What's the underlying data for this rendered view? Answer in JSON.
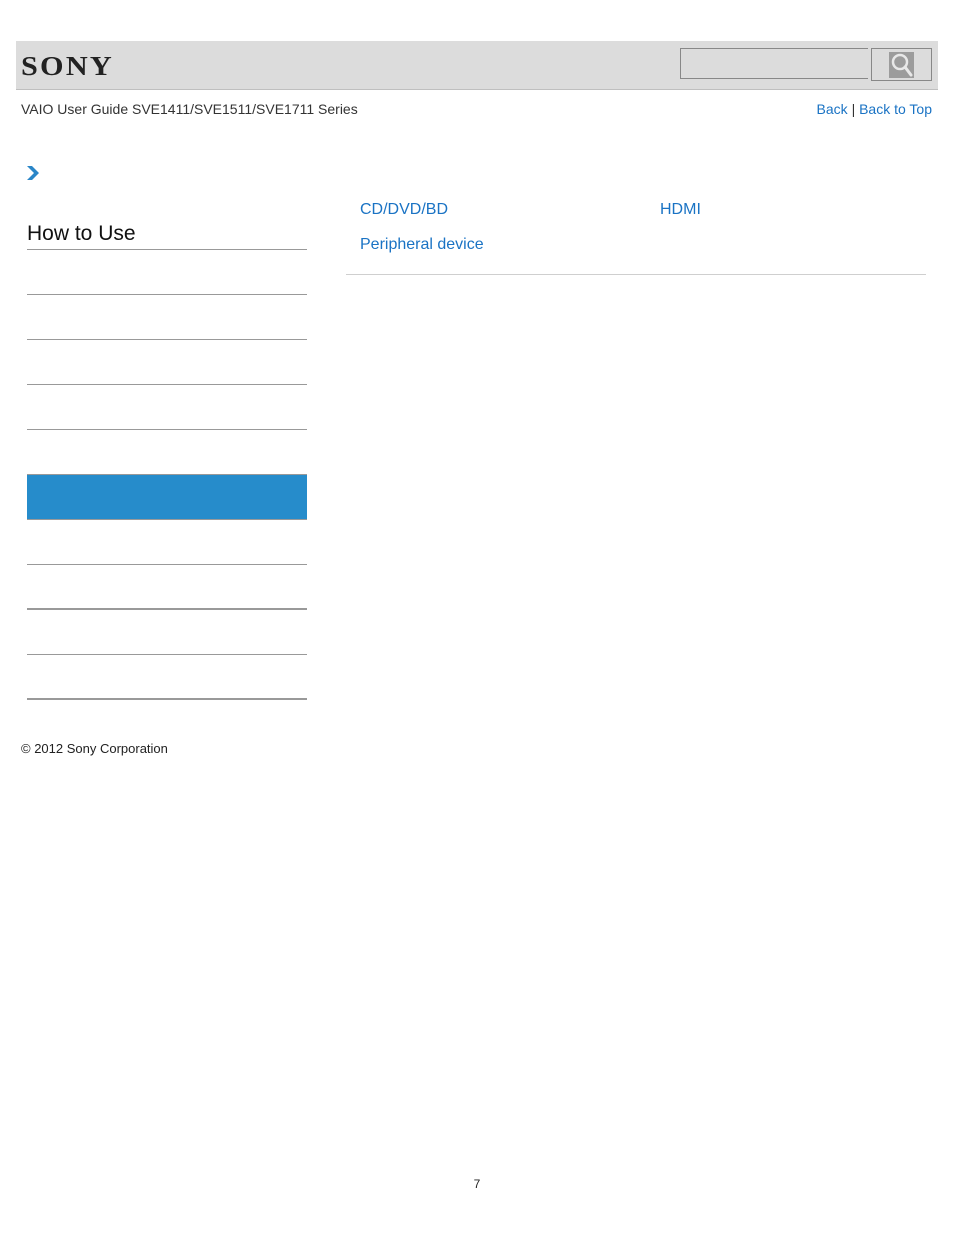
{
  "header": {
    "logo": "SONY",
    "search": {
      "placeholder": "",
      "value": ""
    },
    "search_icon": "search-icon"
  },
  "subheader": {
    "title": "VAIO User Guide SVE1411/SVE1511/SVE1711 Series",
    "back_label": "Back",
    "separator": "|",
    "back_to_top_label": "Back to Top"
  },
  "breadcrumb": {
    "icon": "chevron-right-icon"
  },
  "sidebar": {
    "title": "How to Use",
    "items": [
      {
        "label": "",
        "active": false
      },
      {
        "label": "",
        "active": false
      },
      {
        "label": "",
        "active": false
      },
      {
        "label": "",
        "active": false
      },
      {
        "label": "",
        "active": false
      },
      {
        "label": "",
        "active": true
      },
      {
        "label": "",
        "active": false
      },
      {
        "label": "",
        "active": false
      },
      {
        "label": "",
        "active": false
      },
      {
        "label": "",
        "active": false
      }
    ],
    "active_color": "#268ccb"
  },
  "main": {
    "links": [
      {
        "label": "CD/DVD/BD"
      },
      {
        "label": "HDMI"
      },
      {
        "label": "Peripheral device"
      }
    ],
    "link_color": "#1a73c4"
  },
  "footer": {
    "copyright": "© 2012 Sony Corporation",
    "page_number": "7"
  }
}
